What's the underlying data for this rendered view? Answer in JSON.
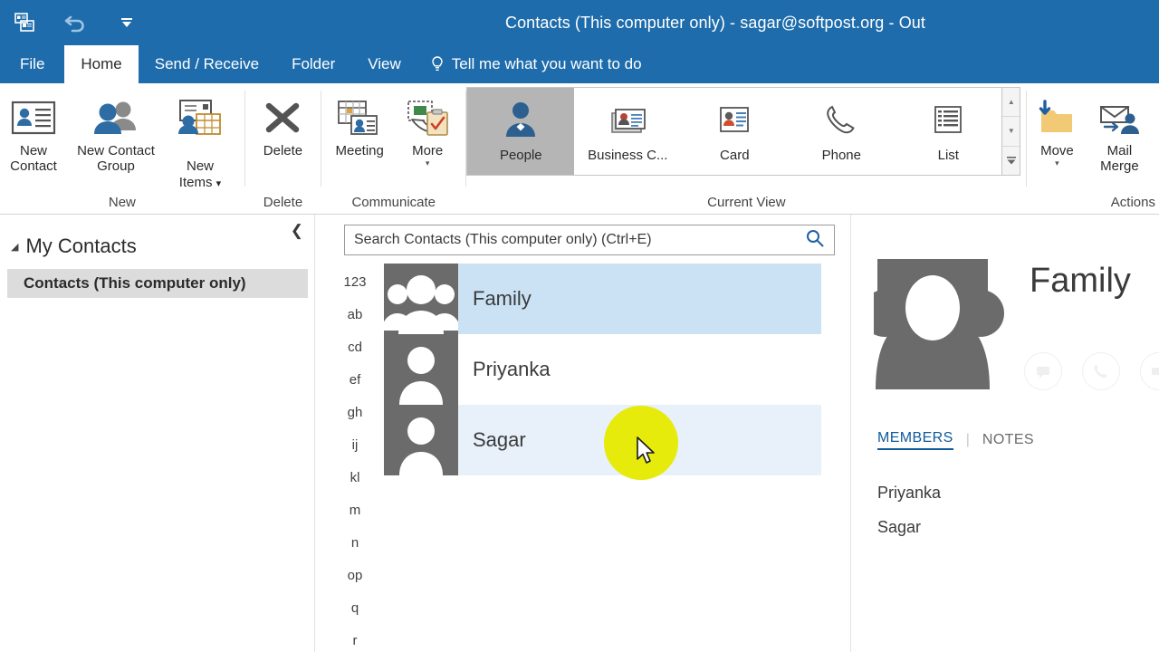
{
  "window": {
    "title": "Contacts (This computer only) - sagar@softpost.org - Out",
    "accent_color": "#1e6cab"
  },
  "quick_access": {
    "items": [
      {
        "name": "outlook-icon",
        "glyph": "outlook"
      },
      {
        "name": "undo-icon",
        "glyph": "undo"
      },
      {
        "name": "customize-qat-icon",
        "glyph": "caret"
      }
    ]
  },
  "tabs": {
    "items": [
      {
        "label": "File",
        "active": false
      },
      {
        "label": "Home",
        "active": true
      },
      {
        "label": "Send / Receive",
        "active": false
      },
      {
        "label": "Folder",
        "active": false
      },
      {
        "label": "View",
        "active": false
      }
    ],
    "tell_me": "Tell me what you want to do"
  },
  "ribbon": {
    "groups": [
      {
        "label": "New",
        "buttons": [
          {
            "label": "New\nContact",
            "icon": "contact-card-icon",
            "caret": false
          },
          {
            "label": "New Contact\nGroup",
            "icon": "contact-group-icon",
            "caret": false
          },
          {
            "label": "New\nItems",
            "icon": "new-items-icon",
            "caret": true,
            "caret_inline": true
          }
        ]
      },
      {
        "label": "Delete",
        "buttons": [
          {
            "label": "Delete",
            "icon": "delete-x-icon",
            "caret": false
          }
        ]
      },
      {
        "label": "Communicate",
        "buttons": [
          {
            "label": "Meeting",
            "icon": "meeting-icon",
            "caret": false
          },
          {
            "label": "More",
            "icon": "more-actions-icon",
            "caret": true
          }
        ]
      },
      {
        "label": "Current View",
        "gallery": {
          "items": [
            {
              "label": "People",
              "icon": "people-view-icon",
              "selected": true
            },
            {
              "label": "Business C...",
              "icon": "business-card-view-icon",
              "selected": false
            },
            {
              "label": "Card",
              "icon": "card-view-icon",
              "selected": false
            },
            {
              "label": "Phone",
              "icon": "phone-view-icon",
              "selected": false
            },
            {
              "label": "List",
              "icon": "list-view-icon",
              "selected": false
            }
          ],
          "scroll_buttons": [
            {
              "name": "gallery-scroll-up-icon",
              "glyph": "▲"
            },
            {
              "name": "gallery-scroll-down-icon",
              "glyph": "▼"
            },
            {
              "name": "gallery-more-icon",
              "glyph": "▼"
            }
          ]
        }
      },
      {
        "label": "Actions",
        "buttons": [
          {
            "label": "Move",
            "icon": "move-folder-icon",
            "caret": true
          },
          {
            "label": "Mail\nMerge",
            "icon": "mail-merge-icon",
            "caret": false
          }
        ]
      }
    ]
  },
  "sidebar": {
    "collapse_label": "❮",
    "header": "My Contacts",
    "items": [
      {
        "label": "Contacts (This computer only)",
        "selected": true
      }
    ]
  },
  "list_pane": {
    "search": {
      "placeholder": "Search Contacts (This computer only) (Ctrl+E)",
      "icon": "search-icon"
    },
    "alpha_index": [
      "123",
      "ab",
      "cd",
      "ef",
      "gh",
      "ij",
      "kl",
      "m",
      "n",
      "op",
      "q",
      "r"
    ],
    "contacts": [
      {
        "name": "Family",
        "type": "group",
        "state": "selected"
      },
      {
        "name": "Priyanka",
        "type": "person",
        "state": "normal"
      },
      {
        "name": "Sagar",
        "type": "person",
        "state": "hover"
      }
    ]
  },
  "reading_pane": {
    "title": "Family",
    "avatar": "contact-group-avatar",
    "actions": [
      {
        "name": "chat-icon"
      },
      {
        "name": "phone-icon"
      },
      {
        "name": "video-icon"
      }
    ],
    "tabs": [
      {
        "label": "MEMBERS",
        "active": true
      },
      {
        "label": "NOTES",
        "active": false
      }
    ],
    "members": [
      "Priyanka",
      "Sagar"
    ]
  },
  "colors": {
    "title_bar": "#1e6cab",
    "selected_row": "#cbe2f4",
    "hover_row": "#e8f0fa",
    "cursor_highlight": "#e6eb0c",
    "link_blue": "#0f5a9c"
  }
}
